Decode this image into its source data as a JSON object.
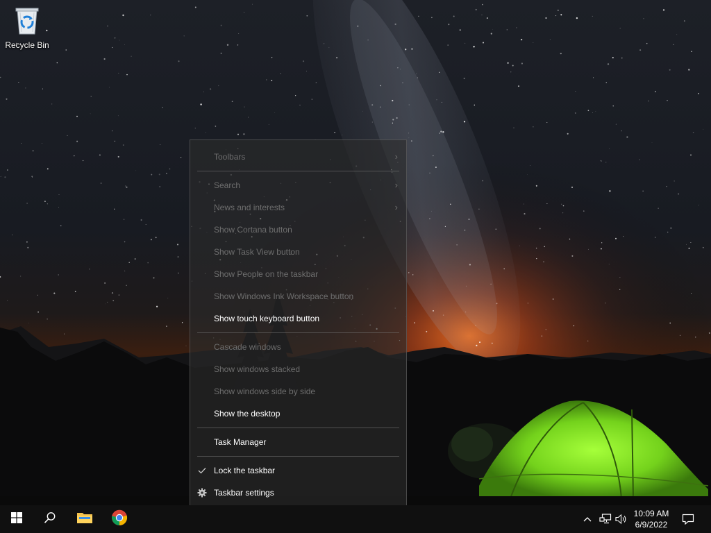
{
  "desktop": {
    "icons": [
      {
        "label": "Recycle Bin",
        "icon": "recycle-bin-icon"
      }
    ]
  },
  "context_menu": {
    "items": [
      {
        "label": "Toolbars",
        "disabled": true,
        "submenu": true
      },
      {
        "label": "Search",
        "disabled": true,
        "submenu": true
      },
      {
        "label": "News and interests",
        "disabled": true,
        "submenu": true
      },
      {
        "label": "Show Cortana button",
        "disabled": true
      },
      {
        "label": "Show Task View button",
        "disabled": true
      },
      {
        "label": "Show People on the taskbar",
        "disabled": true
      },
      {
        "label": "Show Windows Ink Workspace button",
        "disabled": true
      },
      {
        "label": "Show touch keyboard button",
        "disabled": false
      },
      {
        "label": "Cascade windows",
        "disabled": true
      },
      {
        "label": "Show windows stacked",
        "disabled": true
      },
      {
        "label": "Show windows side by side",
        "disabled": true
      },
      {
        "label": "Show the desktop",
        "disabled": false
      },
      {
        "label": "Task Manager",
        "disabled": false
      },
      {
        "label": "Lock the taskbar",
        "disabled": false,
        "checked": true,
        "icon": "checkmark-icon"
      },
      {
        "label": "Taskbar settings",
        "disabled": false,
        "icon": "gear-icon"
      }
    ],
    "submenu_arrow": "›"
  },
  "taskbar": {
    "pinned": [
      {
        "name": "start-button",
        "icon": "windows-logo-icon"
      },
      {
        "name": "search-button",
        "icon": "search-icon"
      },
      {
        "name": "file-explorer-button",
        "icon": "folder-icon"
      },
      {
        "name": "chrome-button",
        "icon": "chrome-icon"
      }
    ],
    "tray": {
      "icons": [
        "chevron-up-icon",
        "network-icon",
        "volume-icon",
        "notification-icon"
      ],
      "time": "10:09 AM",
      "date": "6/9/2022"
    }
  },
  "colors": {
    "menu_text": "#ffffff",
    "menu_disabled_text": "#6e6e6e",
    "taskbar_bg": "#101010",
    "tent_green": "#7fe02a",
    "sunset_orange": "#e8641a"
  }
}
